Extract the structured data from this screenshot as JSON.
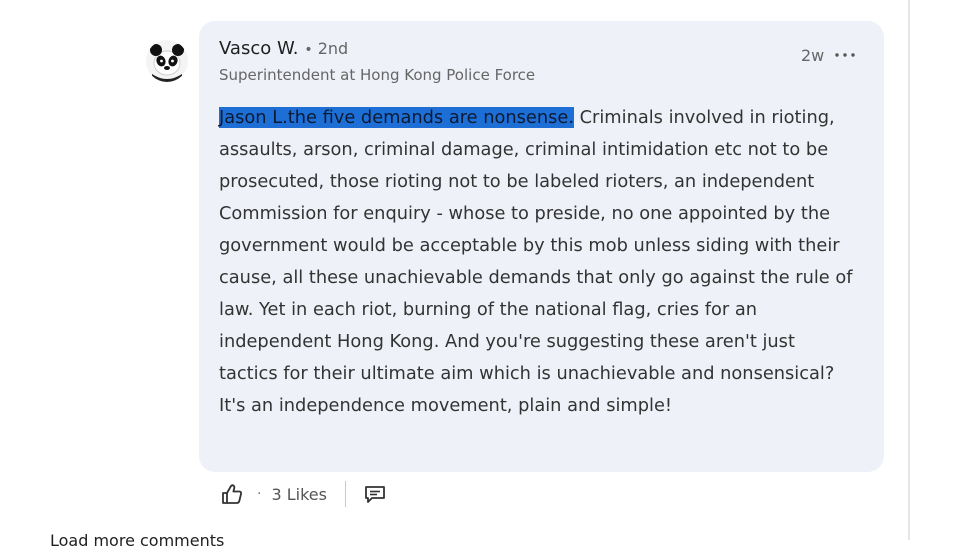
{
  "comment": {
    "author_name": "Vasco W.",
    "separator": "•",
    "connection_degree": "2nd",
    "headline": "Superintendent at Hong Kong Police Force",
    "timestamp": "2w",
    "more_icon": "more-horizontal-icon",
    "avatar_icon": "panda-avatar",
    "body_highlighted": "Jason L.the five demands are nonsense.",
    "body_rest": " Criminals involved in rioting, assaults, arson, criminal damage, criminal intimidation etc not to be prosecuted, those rioting not to be labeled rioters, an independent Commission for enquiry - whose to preside, no one appointed by the government would be acceptable by this mob unless siding with their cause, all these unachievable demands that only go against the rule of law. Yet in each riot, burning of the national flag, cries for an independent Hong Kong. And you're suggesting these aren't just tactics for their ultimate aim which is unachievable and nonsensical? It's an independence movement, plain and simple!",
    "selection_color": "#1d6fd6"
  },
  "actions": {
    "like_icon": "thumbs-up-icon",
    "dot": "·",
    "likes_count": "3 Likes",
    "reply_icon": "comment-reply-icon"
  },
  "footer": {
    "load_more": "Load more comments"
  },
  "colors": {
    "bubble": "#eef2f8",
    "text": "#333333",
    "muted": "#666666"
  }
}
